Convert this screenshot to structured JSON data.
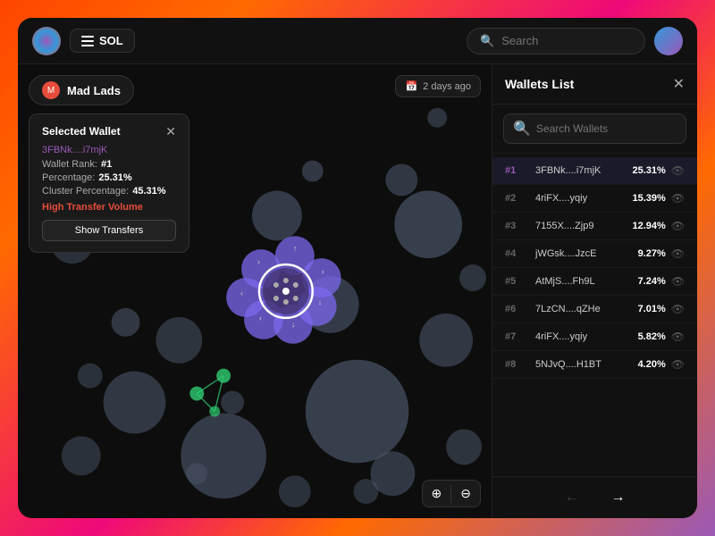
{
  "header": {
    "sol_label": "SOL",
    "search_placeholder": "Search"
  },
  "collection": {
    "name": "Mad Lads",
    "time_label": "2 days ago"
  },
  "popup": {
    "title": "Selected Wallet",
    "address": "3FBNk....i7mjK",
    "rank_label": "Wallet Rank:",
    "rank_value": "#1",
    "pct_label": "Percentage:",
    "pct_value": "25.31%",
    "cluster_label": "Cluster Percentage:",
    "cluster_value": "45.31%",
    "high_transfer": "High Transfer Volume",
    "show_transfers": "Show Transfers"
  },
  "panel": {
    "title": "Wallets List",
    "search_placeholder": "Search Wallets",
    "wallets": [
      {
        "rank": "#1",
        "addr": "3FBNk....i7mjK",
        "pct": "25.31%",
        "active": true
      },
      {
        "rank": "#2",
        "addr": "4riFX....yqiy",
        "pct": "15.39%",
        "active": false
      },
      {
        "rank": "#3",
        "addr": "7155X....Zjp9",
        "pct": "12.94%",
        "active": false
      },
      {
        "rank": "#4",
        "addr": "jWGsk....JzcE",
        "pct": "9.27%",
        "active": false
      },
      {
        "rank": "#5",
        "addr": "AtMjS....Fh9L",
        "pct": "7.24%",
        "active": false
      },
      {
        "rank": "#6",
        "addr": "7LzCN....qZHe",
        "pct": "7.01%",
        "active": false
      },
      {
        "rank": "#7",
        "addr": "4riFX....yqiy",
        "pct": "5.82%",
        "active": false
      },
      {
        "rank": "#8",
        "addr": "5NJvQ....H1BT",
        "pct": "4.20%",
        "active": false
      }
    ]
  },
  "zoom": {
    "in": "⊕",
    "out": "⊖"
  }
}
